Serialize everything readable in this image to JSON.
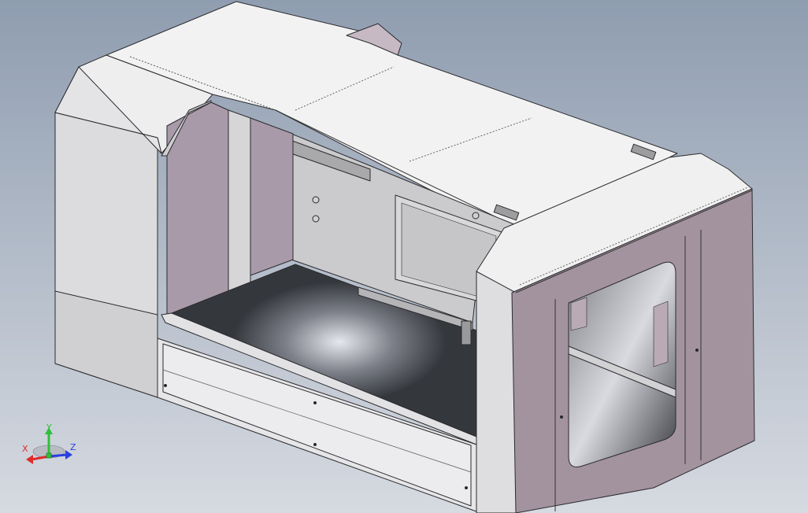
{
  "viewport": {
    "background_top": "#8f9db0",
    "background_bottom": "#d4d8df",
    "edge_color": "#2b2b2e",
    "panel_light": "#e8e8ea",
    "panel_mid": "#cfcfd2",
    "panel_purple": "#9c8d9b",
    "panel_purple_light": "#b3a6b3",
    "floor_dark": "#34373c"
  },
  "triad": {
    "x_label": "X",
    "y_label": "Y",
    "z_label": "Z",
    "x_color": "#e02b2b",
    "y_color": "#2fbf3a",
    "z_color": "#2a3fe0"
  }
}
